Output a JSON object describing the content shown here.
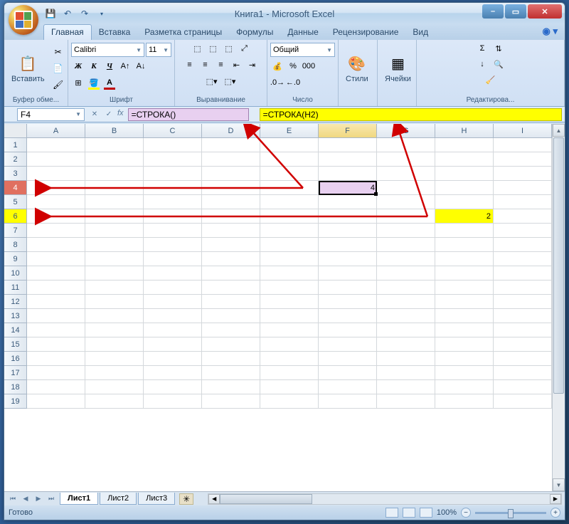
{
  "title": "Книга1 - Microsoft Excel",
  "qat": {
    "save": "💾",
    "undo": "↶",
    "redo": "↷"
  },
  "tabs": [
    "Главная",
    "Вставка",
    "Разметка страницы",
    "Формулы",
    "Данные",
    "Рецензирование",
    "Вид"
  ],
  "ribbon": {
    "clipboard": {
      "label": "Буфер обме...",
      "paste": "Вставить"
    },
    "font": {
      "label": "Шрифт",
      "name": "Calibri",
      "size": "11"
    },
    "align": {
      "label": "Выравнивание"
    },
    "number": {
      "label": "Число",
      "format": "Общий"
    },
    "styles": {
      "label": "Стили"
    },
    "cells": {
      "label": "Ячейки"
    },
    "editing": {
      "label": "Редактирова..."
    }
  },
  "formula": {
    "namebox": "F4",
    "fx": "fx",
    "box1": "=СТРОКА()",
    "box2": "=СТРОКА(H2)"
  },
  "cols": [
    "A",
    "B",
    "C",
    "D",
    "E",
    "F",
    "G",
    "H",
    "I"
  ],
  "rows_count": 19,
  "cells": {
    "F4": "4",
    "H6": "2"
  },
  "sheets": [
    "Лист1",
    "Лист2",
    "Лист3"
  ],
  "status": {
    "ready": "Готово",
    "zoom": "100%"
  }
}
